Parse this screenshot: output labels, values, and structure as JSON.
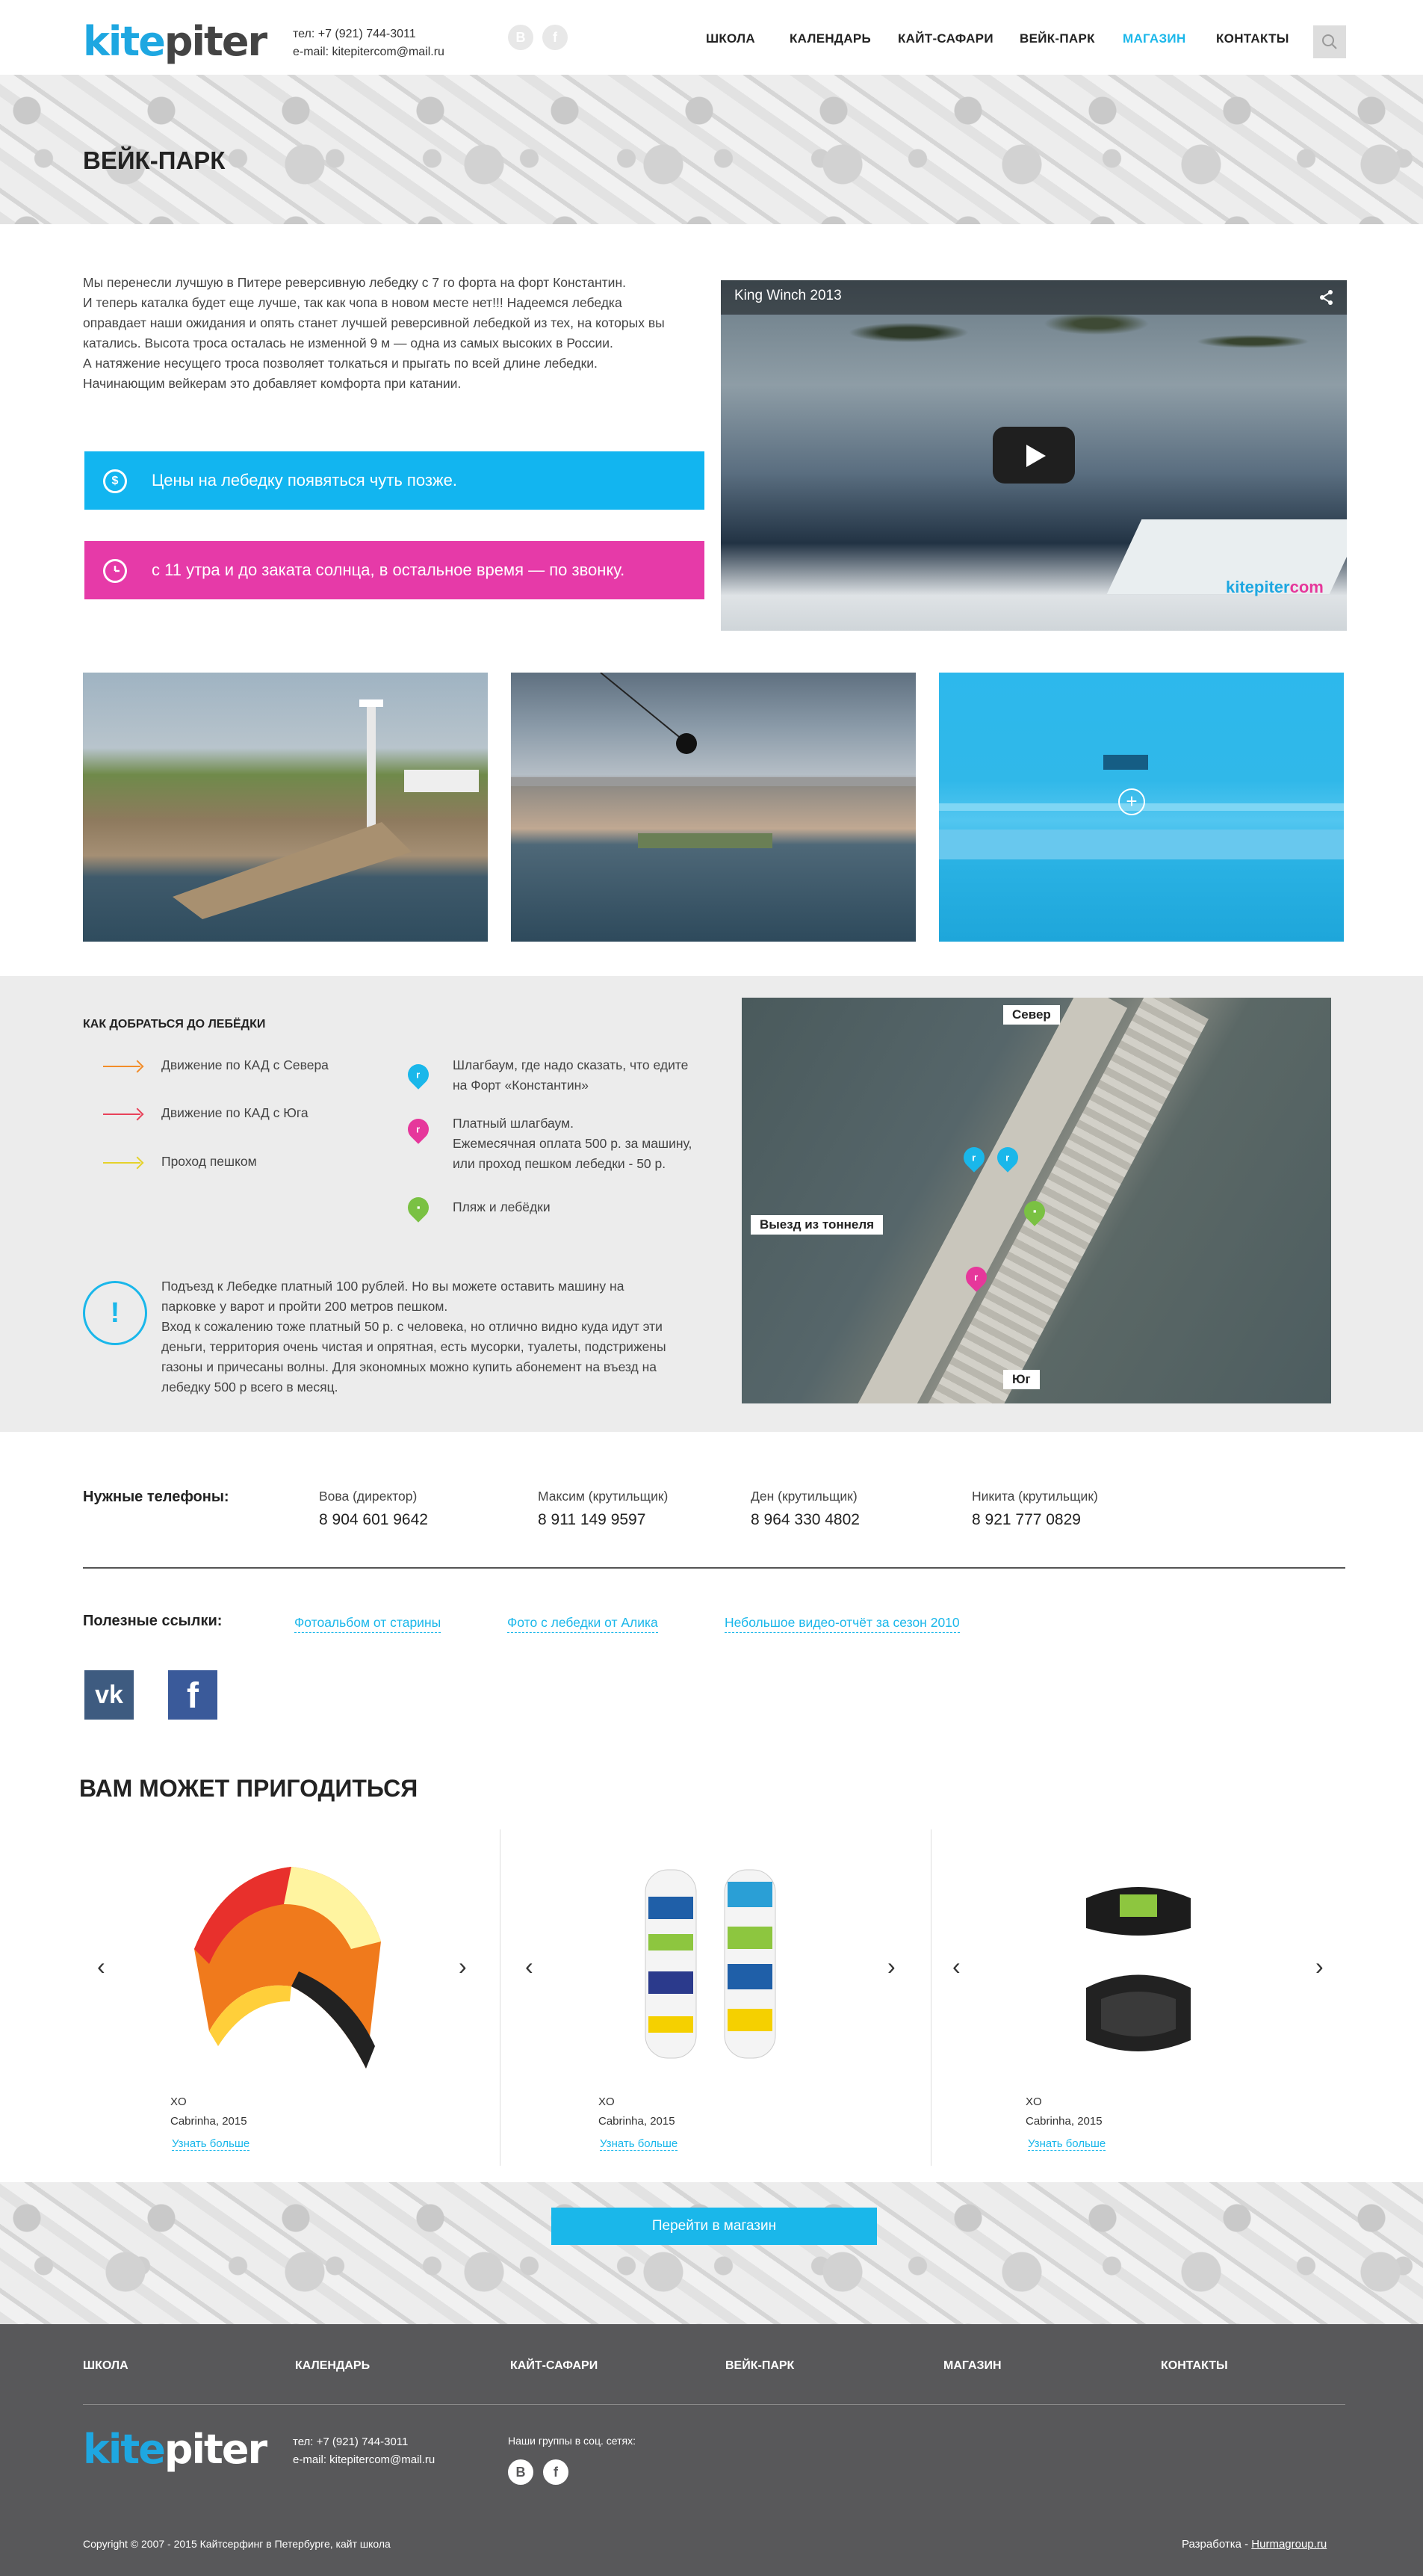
{
  "header": {
    "logo_part1": "kite",
    "logo_part2": "piter",
    "phone": "тел: +7 (921) 744-3011",
    "email": "e-mail: kitepitercom@mail.ru",
    "social": [
      "В",
      "f"
    ],
    "nav": [
      "ШКОЛА",
      "КАЛЕНДАРЬ",
      "КАЙТ-САФАРИ",
      "ВЕЙК-ПАРК",
      "МАГАЗИН",
      "КОНТАКТЫ"
    ],
    "active_nav": "МАГАЗИН"
  },
  "page": {
    "title": "ВЕЙК-ПАРК",
    "intro": [
      "Мы перенесли лучшую в Питере реверсивную лебедку с 7 го форта на форт Константин.",
      "И теперь каталка будет еще лучше, так как чопа в новом месте нет!!!  Надеемся лебедка",
      "оправдает наши ожидания и опять станет лучшей реверсивной лебедкой из тех, на которых вы",
      "катались. Высота троса осталась не изменной 9 м — одна из самых высоких в России.",
      "А натяжение несущего троса позволяет толкаться и прыгать по всей длине лебедки.",
      "Начинающим вейкерам это добавляет комфорта при катании."
    ],
    "price_notice": "Цены на лебедку появяться чуть позже.",
    "hours_notice": "с 11 утра и до заката солнца, в остальное время — по звонку.",
    "video_title": "King Winch 2013",
    "video_watermark_1": "kitepiter",
    "video_watermark_2": "com"
  },
  "directions": {
    "title": "КАК ДОБРАТЬСЯ ДО ЛЕБЁДКИ",
    "routes": [
      {
        "label": "Движение по КАД с Севера",
        "color": "#f28c28"
      },
      {
        "label": "Движение по КАД с Юга",
        "color": "#e8425a"
      },
      {
        "label": "Проход пешком",
        "color": "#e5d22b"
      }
    ],
    "points": [
      {
        "text1": "Шлагбаум, где надо сказать, что едите",
        "text2": "на Форт «Константин»",
        "text3": "",
        "color": "#1ab7ea",
        "icon": "parking-pin-icon"
      },
      {
        "text1": "Платный шлагбаум.",
        "text2": "Ежемесячная оплата 500 р. за машину,",
        "text3": "или проход пешком лебедки  - 50 р.",
        "color": "#e6379b",
        "icon": "parking-pin-icon"
      },
      {
        "text1": "Пляж и лебёдки",
        "text2": "",
        "text3": "",
        "color": "#7ac143",
        "icon": "beach-pin-icon"
      }
    ],
    "note": [
      "Подъезд к Лебедке платный 100 рублей. Но вы можете оставить машину на",
      "парковке у варот и пройти 200 метров пешком.",
      "Вход к сожалению тоже платный 50 р. с человека, но отлично видно куда идут эти",
      "деньги, территория очень чистая и опрятная, есть мусорки, туалеты, подстрижены",
      "газоны и причесаны волны. Для экономных можно купить абонемент на въезд на",
      "лебедку 500 р всего в месяц."
    ],
    "map_labels": {
      "north": "Север",
      "tunnel": "Выезд из тоннеля",
      "south": "Юг"
    }
  },
  "phones": {
    "title": "Нужные телефоны:",
    "contacts": [
      {
        "name": "Вова (директор)",
        "number": "8 904 601 9642"
      },
      {
        "name": "Максим (крутильщик)",
        "number": "8 911 149 9597"
      },
      {
        "name": "Ден (крутильщик)",
        "number": "8 964 330 4802"
      },
      {
        "name": "Никита (крутильщик)",
        "number": "8 921 777 0829"
      }
    ]
  },
  "links": {
    "title": "Полезные ссылки:",
    "items": [
      "Фотоальбом от старины",
      "Фото с лебедки от Алика",
      "Небольшое видео-отчёт за сезон 2010"
    ],
    "vk": "vk",
    "fb": "f"
  },
  "products": {
    "title": "ВАМ МОЖЕТ ПРИГОДИТЬСЯ",
    "items": [
      {
        "name": "XO",
        "sub": "Cabrinha, 2015",
        "more": "Узнать больше"
      },
      {
        "name": "XO",
        "sub": "Cabrinha, 2015",
        "more": "Узнать больше"
      },
      {
        "name": "XO",
        "sub": "Cabrinha, 2015",
        "more": "Узнать больше"
      }
    ],
    "prev": "‹",
    "next": "›",
    "shop_button": "Перейти в магазин"
  },
  "footer": {
    "nav": [
      "ШКОЛА",
      "КАЛЕНДАРЬ",
      "КАЙТ-САФАРИ",
      "ВЕЙК-ПАРК",
      "МАГАЗИН",
      "КОНТАКТЫ"
    ],
    "phone": "тел: +7 (921) 744-3011",
    "email": "e-mail: kitepitercom@mail.ru",
    "groups": "Наши группы в соц. сетях:",
    "social": [
      "В",
      "f"
    ],
    "copyright": "Copyright © 2007 - 2015 Кайтсерфинг в Петербурге, кайт школа",
    "dev_label": "Разработка - ",
    "dev_link": "Hurmagroup.ru"
  }
}
